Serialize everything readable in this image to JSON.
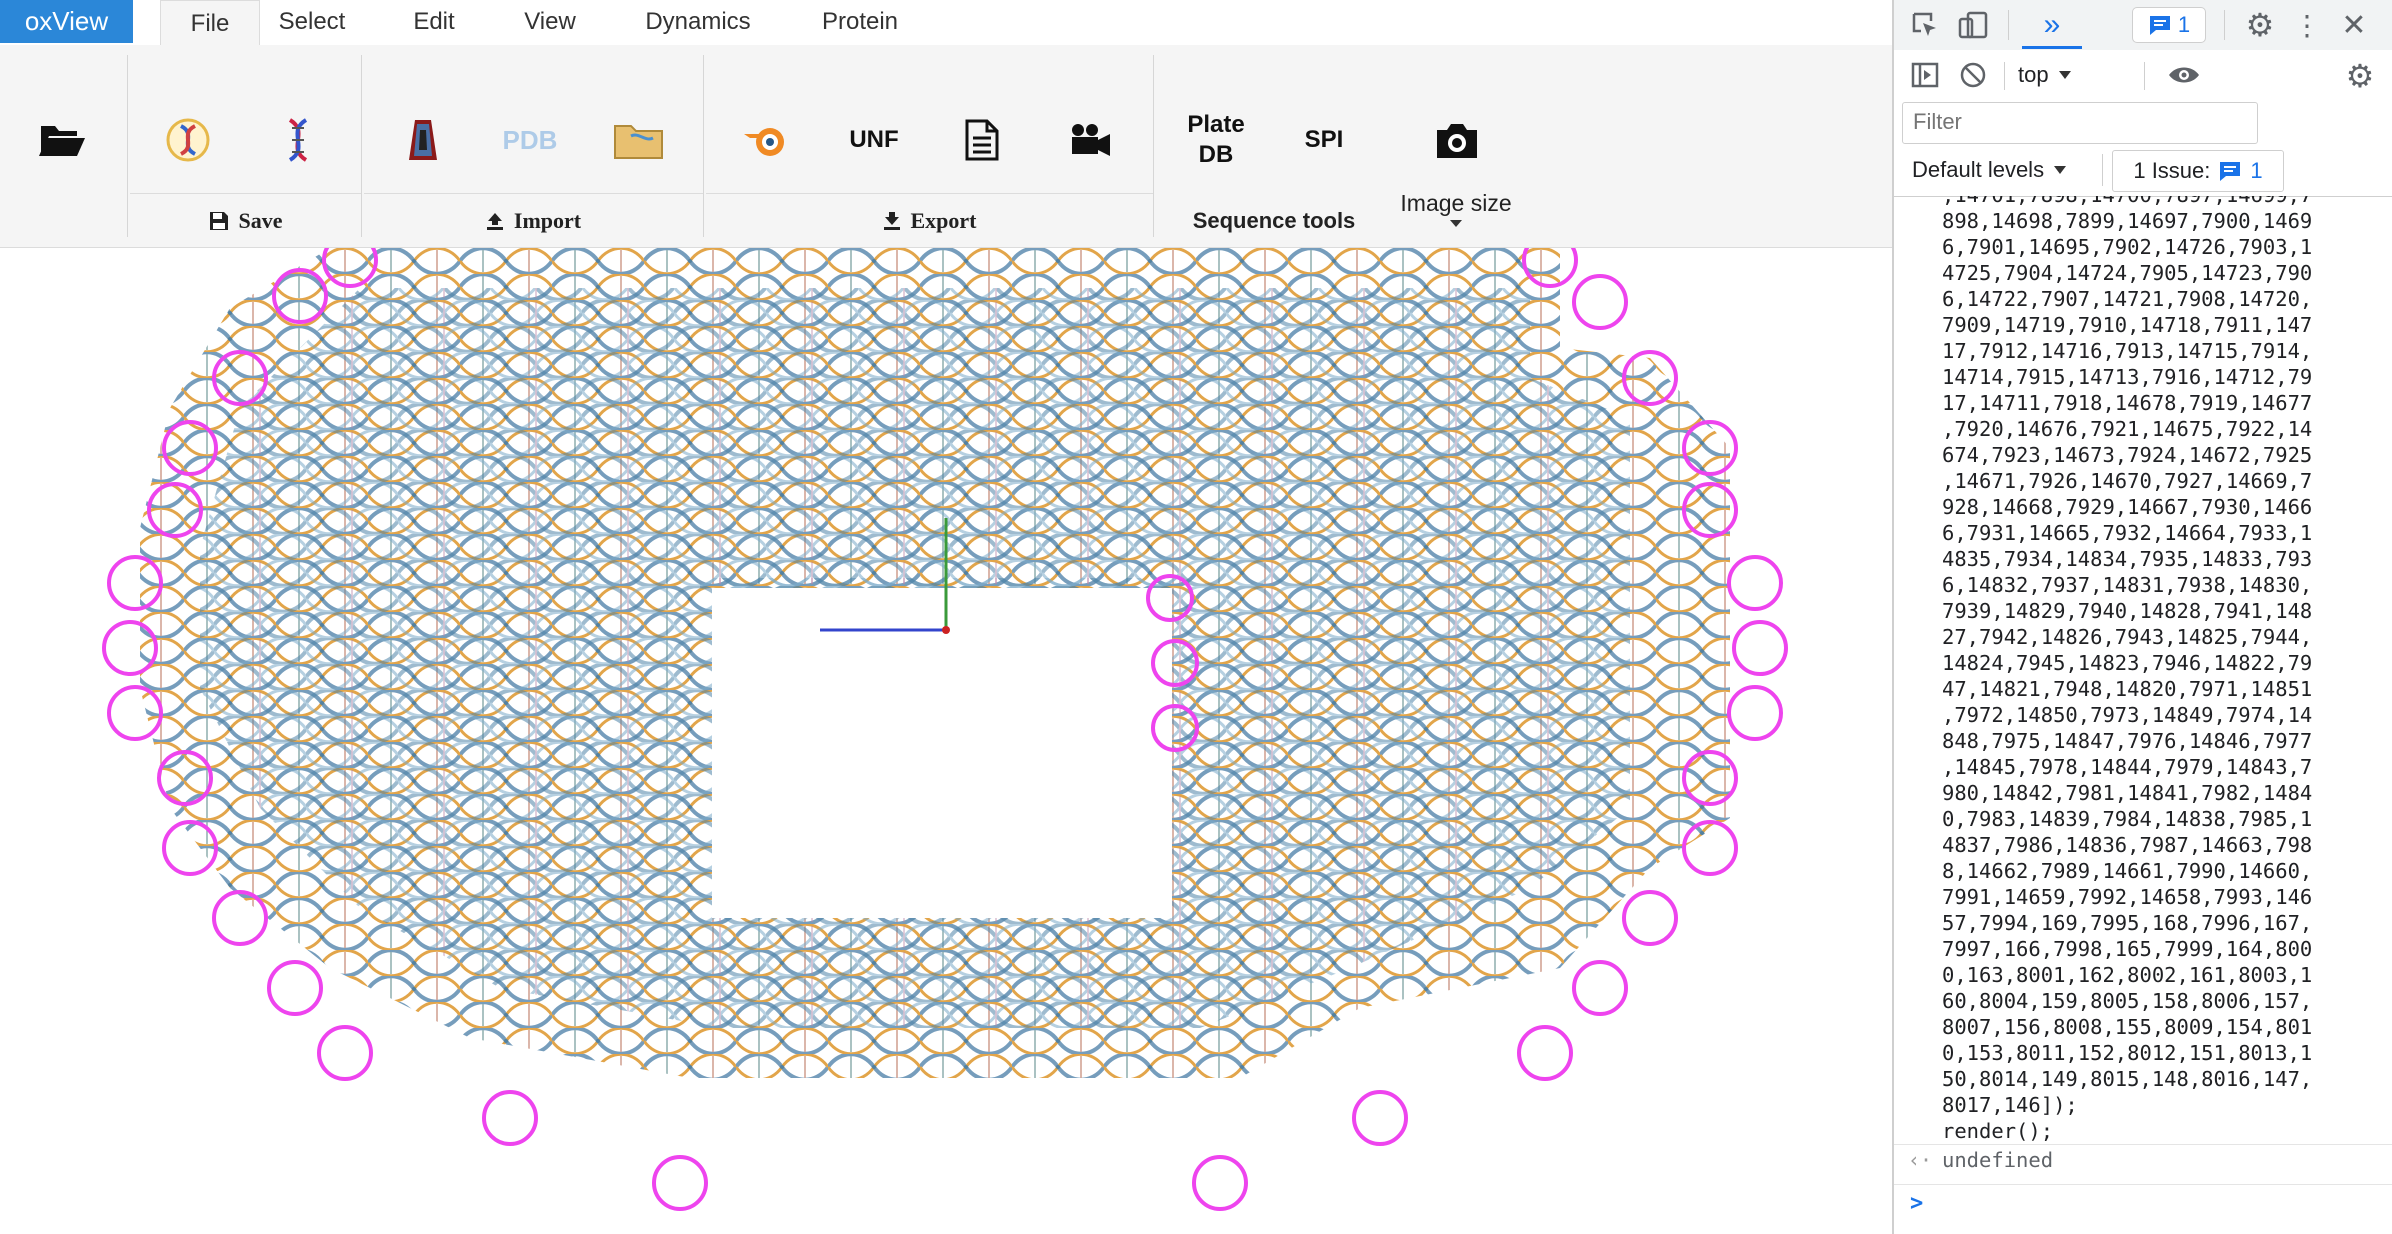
{
  "app": {
    "brand": "oxView"
  },
  "menu": {
    "tabs": [
      "File",
      "Select",
      "Edit",
      "View",
      "Dynamics",
      "Protein"
    ],
    "active": "File"
  },
  "ribbon": {
    "buttons": {
      "unf": "UNF",
      "plate": "Plate\nDB",
      "spi": "SPI"
    },
    "groups": {
      "save": "Save",
      "import": "Import",
      "export": "Export",
      "sequence_tools": "Sequence tools",
      "image_size": "Image size"
    }
  },
  "colors": {
    "brand": "#2b87d8",
    "strand_blue": "#5b8db0",
    "strand_orange": "#e0a040",
    "loop_magenta": "#ee44ee",
    "axis_green": "#3a9a3a",
    "axis_blue": "#3344cc",
    "axis_red": "#cc2222",
    "devtools_accent": "#1a73e8"
  },
  "devtools": {
    "issue_badge": "1",
    "context": "top",
    "filter_placeholder": "Filter",
    "levels": "Default levels",
    "issues_label": "1 Issue:",
    "issues_count": "1",
    "console_lines": [
      ",14701,7898,14700,7897,14699,7",
      "898,14698,7899,14697,7900,1469",
      "6,7901,14695,7902,14726,7903,1",
      "4725,7904,14724,7905,14723,790",
      "6,14722,7907,14721,7908,14720,",
      "7909,14719,7910,14718,7911,147",
      "17,7912,14716,7913,14715,7914,",
      "14714,7915,14713,7916,14712,79",
      "17,14711,7918,14678,7919,14677",
      ",7920,14676,7921,14675,7922,14",
      "674,7923,14673,7924,14672,7925",
      ",14671,7926,14670,7927,14669,7",
      "928,14668,7929,14667,7930,1466",
      "6,7931,14665,7932,14664,7933,1",
      "4835,7934,14834,7935,14833,793",
      "6,14832,7937,14831,7938,14830,",
      "7939,14829,7940,14828,7941,148",
      "27,7942,14826,7943,14825,7944,",
      "14824,7945,14823,7946,14822,79",
      "47,14821,7948,14820,7971,14851",
      ",7972,14850,7973,14849,7974,14",
      "848,7975,14847,7976,14846,7977",
      ",14845,7978,14844,7979,14843,7",
      "980,14842,7981,14841,7982,1484",
      "0,7983,14839,7984,14838,7985,1",
      "4837,7986,14836,7987,14663,798",
      "8,14662,7989,14661,7990,14660,",
      "7991,14659,7992,14658,7993,146",
      "57,7994,169,7995,168,7996,167,",
      "7997,166,7998,165,7999,164,800",
      "0,163,8001,162,8002,161,8003,1",
      "60,8004,159,8005,158,8006,157,",
      "8007,156,8008,155,8009,154,801",
      "0,153,8011,152,8012,151,8013,1",
      "50,8014,149,8015,148,8016,147,",
      "8017,146]);",
      "render();"
    ],
    "result": "undefined",
    "prompt_symbol": ">"
  }
}
